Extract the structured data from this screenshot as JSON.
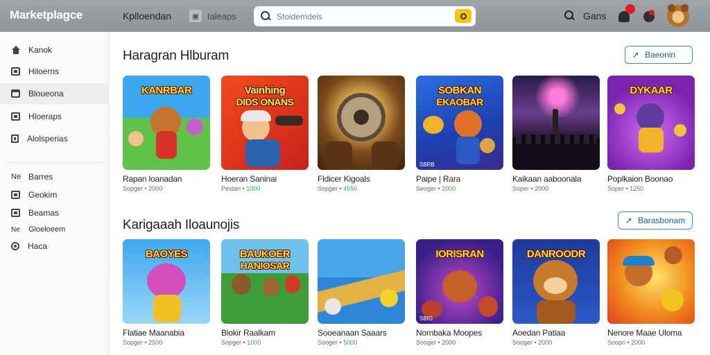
{
  "header": {
    "brand": "Marketplagce",
    "tab1": "Kplloendan",
    "tab2": "Ialeaps",
    "search_placeholder": "Stoidemdeis",
    "games_label": "Gans",
    "notification_count": ""
  },
  "sidebar": {
    "items": [
      {
        "label": "Kanok",
        "icon": "home-icon"
      },
      {
        "label": "Hiloerns",
        "icon": "box-icon"
      },
      {
        "label": "Bloueona",
        "icon": "calendar-icon"
      },
      {
        "label": "Hloeraps",
        "icon": "box-icon"
      },
      {
        "label": "Alolsperias",
        "icon": "document-icon"
      }
    ],
    "group_items": [
      {
        "prefix": "Ne",
        "label": "Barres"
      },
      {
        "label": "Geokim",
        "icon": "box-icon"
      },
      {
        "label": "Beamas",
        "icon": "box-icon"
      },
      {
        "prefix": "Ne",
        "label": "Gloeloeem"
      },
      {
        "label": "Haca",
        "icon": "circle-icon"
      }
    ]
  },
  "sections": [
    {
      "title": "Haragran Hlburam",
      "button": "Baeonin",
      "cards": [
        {
          "thumb_title": "KANRBAR",
          "thumb_sub": "",
          "foot": "",
          "title": "Rapan loanadan",
          "meta": "Sopger • 2000",
          "meta_extra": ""
        },
        {
          "thumb_title": "Vainhing",
          "thumb_sub": "DIDS ONANS",
          "foot": "",
          "title": "Hoeran Saninai",
          "meta": "Peidan • ",
          "meta_extra": "1000"
        },
        {
          "thumb_title": "",
          "thumb_sub": "",
          "foot": "",
          "title": "Fldicer Kigoals",
          "meta": "Sopger • ",
          "meta_extra": "4550"
        },
        {
          "thumb_title": "SOBKAN",
          "thumb_sub": "EKAOBAR",
          "foot": "SBRB",
          "title": "Paipe | Rara",
          "meta": "Seoger • ",
          "meta_extra": "2000"
        },
        {
          "thumb_title": "",
          "thumb_sub": "",
          "foot": "",
          "title": "Kaikaan aaboonala",
          "meta": "Soper • 2000",
          "meta_extra": ""
        },
        {
          "thumb_title": "DYKAAR",
          "thumb_sub": "",
          "foot": "",
          "title": "Poplkaion Boonao",
          "meta": "Soper • 1250",
          "meta_extra": ""
        }
      ]
    },
    {
      "title": "Karigaaah Iloaunojis",
      "button": "Barasbonam",
      "cards": [
        {
          "thumb_title": "BAOYES",
          "thumb_sub": "",
          "foot": "",
          "title": "Flatiae Maanabia",
          "meta": "Sopger • 2500",
          "meta_extra": ""
        },
        {
          "thumb_title": "BAUKOER",
          "thumb_sub": "HANIOSAR",
          "foot": "",
          "title": "Blokir Raalkam",
          "meta": "Sopger • ",
          "meta_extra": "1000"
        },
        {
          "thumb_title": "",
          "thumb_sub": "",
          "foot": "",
          "title": "Sooeanaan Saaars",
          "meta": "Sooger • ",
          "meta_extra": "5000"
        },
        {
          "thumb_title": "IORISRAN",
          "thumb_sub": "",
          "foot": "SBIG",
          "title": "Nornbaka Moopes",
          "meta": "Sooger • 2000",
          "meta_extra": ""
        },
        {
          "thumb_title": "DANROODR",
          "thumb_sub": "",
          "foot": "",
          "title": "Aoedan Patiaa",
          "meta": "Sooger • 2000",
          "meta_extra": ""
        },
        {
          "thumb_title": "",
          "thumb_sub": "",
          "foot": "",
          "title": "Nenore Maae Uloma",
          "meta": "Soopri • 2000",
          "meta_extra": ""
        }
      ]
    }
  ],
  "colors": {
    "header_bg": "#969ca0",
    "accent": "#2f8fd6",
    "search_button": "#f2c413",
    "positive": "#3aa24a"
  }
}
